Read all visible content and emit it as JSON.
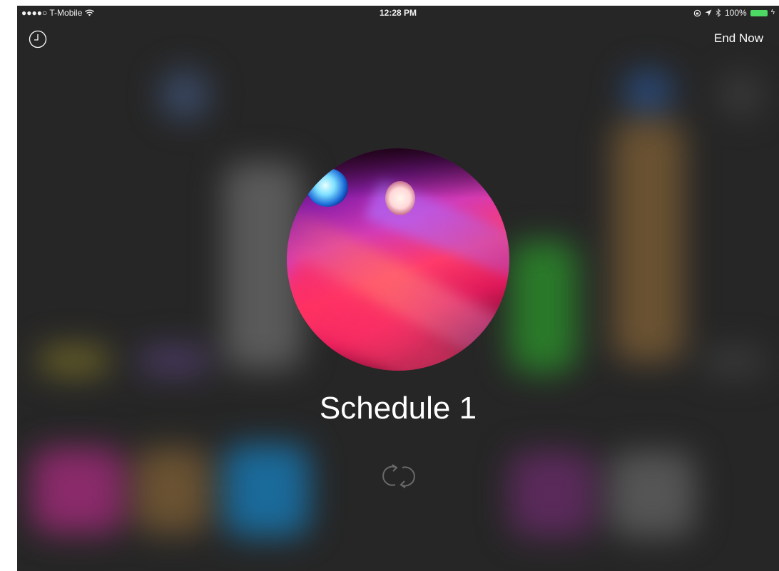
{
  "status_bar": {
    "carrier": "●●●●○ T-Mobile",
    "time": "12:28 PM",
    "battery_percent": "100%"
  },
  "header": {
    "history_icon": "clock-icon",
    "end_now_label": "End Now"
  },
  "scene": {
    "title": "Schedule 1",
    "repeat_icon": "repeat-icon"
  },
  "colors": {
    "background": "#262626",
    "battery": "#4cd964",
    "text": "#ffffff"
  }
}
